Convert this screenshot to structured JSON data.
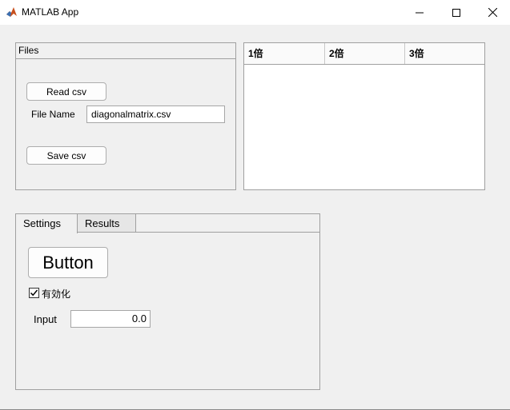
{
  "window": {
    "title": "MATLAB App",
    "icon": "matlab-logo-icon",
    "controls": [
      "minimize-icon",
      "maximize-icon",
      "close-icon"
    ]
  },
  "files_panel": {
    "title": "Files",
    "read_button": "Read csv",
    "file_name_label": "File Name",
    "file_name_value": "diagonalmatrix.csv",
    "save_button": "Save csv"
  },
  "table": {
    "columns": [
      "1倍",
      "2倍",
      "3倍"
    ],
    "rows": []
  },
  "tabs": {
    "items": [
      {
        "label": "Settings",
        "selected": true
      },
      {
        "label": "Results",
        "selected": false
      }
    ],
    "settings": {
      "button_label": "Button",
      "checkbox_label": "有効化",
      "checkbox_checked": true,
      "input_label": "Input",
      "input_value": "0.0"
    }
  }
}
